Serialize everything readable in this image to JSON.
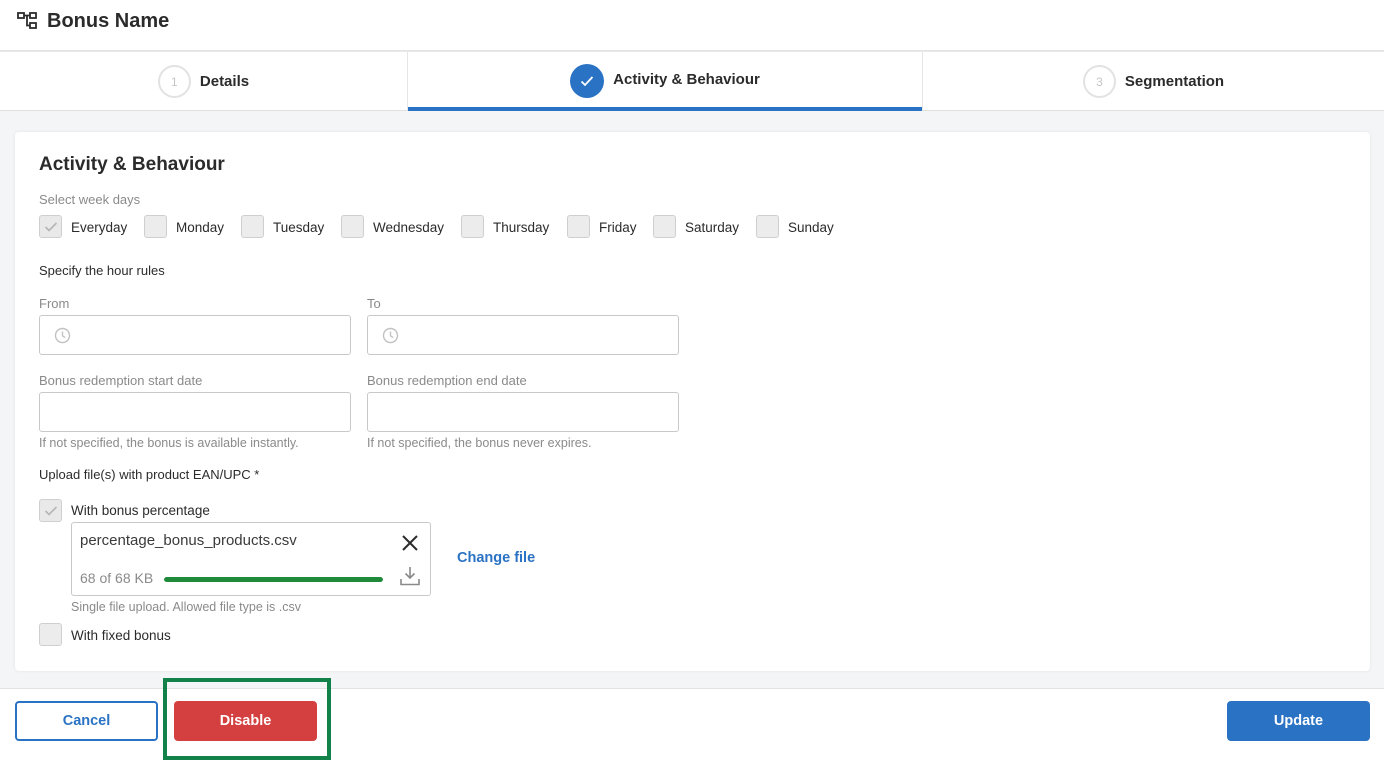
{
  "header": {
    "title": "Bonus Name",
    "icon": "hierarchy-icon"
  },
  "steps": [
    {
      "number": "1",
      "label": "Details",
      "state": "pending"
    },
    {
      "number": "2",
      "label": "Activity & Behaviour",
      "state": "active"
    },
    {
      "number": "3",
      "label": "Segmentation",
      "state": "pending"
    }
  ],
  "card": {
    "title": "Activity & Behaviour",
    "weekdays_label": "Select week days",
    "weekdays": [
      {
        "label": "Everyday",
        "checked": true
      },
      {
        "label": "Monday",
        "checked": false
      },
      {
        "label": "Tuesday",
        "checked": false
      },
      {
        "label": "Wednesday",
        "checked": false
      },
      {
        "label": "Thursday",
        "checked": false
      },
      {
        "label": "Friday",
        "checked": false
      },
      {
        "label": "Saturday",
        "checked": false
      },
      {
        "label": "Sunday",
        "checked": false
      }
    ],
    "hour_rules_label": "Specify the hour rules",
    "from_label": "From",
    "from_value": "",
    "to_label": "To",
    "to_value": "",
    "start_date_label": "Bonus redemption start date",
    "start_date_value": "",
    "start_date_help": "If not specified, the bonus is available instantly.",
    "end_date_label": "Bonus redemption end date",
    "end_date_value": "",
    "end_date_help": "If not specified, the bonus never expires.",
    "upload_label": "Upload file(s) with product EAN/UPC *",
    "with_percentage_label": "With bonus percentage",
    "with_percentage_checked": true,
    "file": {
      "name": "percentage_bonus_products.csv",
      "size_text": "68 of 68 KB",
      "progress": 1.0
    },
    "change_file_label": "Change file",
    "file_help": "Single file upload. Allowed file type is .csv",
    "with_fixed_label": "With fixed bonus",
    "with_fixed_checked": false
  },
  "footer": {
    "cancel_label": "Cancel",
    "disable_label": "Disable",
    "update_label": "Update"
  },
  "colors": {
    "primary": "#2a72c3",
    "danger": "#d43f3f",
    "progress": "#1e8a3a",
    "highlight": "#12824a"
  }
}
